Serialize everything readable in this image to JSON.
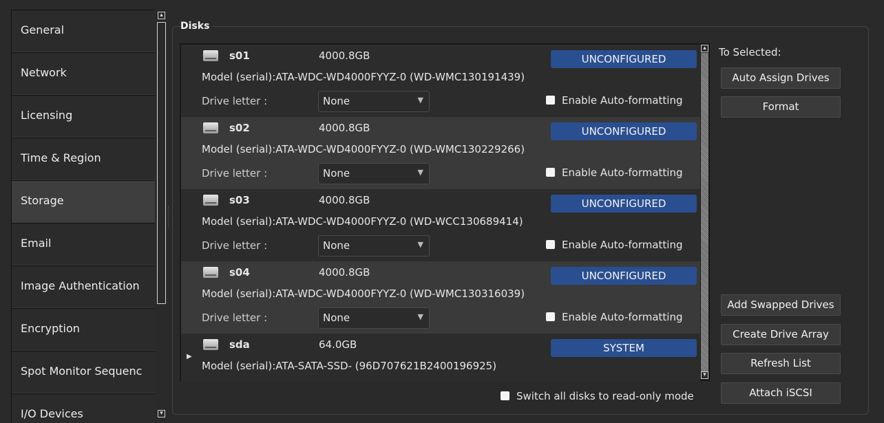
{
  "sidebar": {
    "items": [
      {
        "label": "General"
      },
      {
        "label": "Network"
      },
      {
        "label": "Licensing"
      },
      {
        "label": "Time & Region"
      },
      {
        "label": "Storage"
      },
      {
        "label": "Email"
      },
      {
        "label": "Image Authentication"
      },
      {
        "label": "Encryption"
      },
      {
        "label": "Spot Monitor Sequenc"
      },
      {
        "label": "I/O Devices"
      }
    ],
    "selected": "Storage"
  },
  "disks": {
    "group_title": "Disks",
    "drive_letter_label": "Drive letter :",
    "autoformat_label": "Enable Auto-formatting",
    "items": [
      {
        "name": "s01",
        "size": "4000.8GB",
        "status": "UNCONFIGURED",
        "model": "Model (serial):ATA-WDC-WD4000FYYZ-0 (WD-WMC130191439)",
        "drive_letter": "None"
      },
      {
        "name": "s02",
        "size": "4000.8GB",
        "status": "UNCONFIGURED",
        "model": "Model (serial):ATA-WDC-WD4000FYYZ-0 (WD-WMC130229266)",
        "drive_letter": "None"
      },
      {
        "name": "s03",
        "size": "4000.8GB",
        "status": "UNCONFIGURED",
        "model": "Model (serial):ATA-WDC-WD4000FYYZ-0 (WD-WCC130689414)",
        "drive_letter": "None"
      },
      {
        "name": "s04",
        "size": "4000.8GB",
        "status": "UNCONFIGURED",
        "model": "Model (serial):ATA-WDC-WD4000FYYZ-0 (WD-WMC130316039)",
        "drive_letter": "None"
      },
      {
        "name": "sda",
        "size": "64.0GB",
        "status": "SYSTEM",
        "model": "Model (serial):ATA-SATA-SSD- (96D707621B2400196925)"
      }
    ],
    "readonly_label": "Switch all disks to read-only mode"
  },
  "actions": {
    "to_selected_label": "To Selected:",
    "auto_assign": "Auto Assign Drives",
    "format": "Format",
    "add_swapped": "Add Swapped Drives",
    "create_array": "Create Drive Array",
    "refresh": "Refresh List",
    "attach_iscsi": "Attach iSCSI"
  },
  "icons": {
    "drive": "hard-drive-icon",
    "select_caret": "chevron-down-icon",
    "expander": "triangle-right-icon",
    "scroll_up": "scroll-up-icon",
    "scroll_down": "scroll-down-icon"
  },
  "colors": {
    "background": "#2a2a2a",
    "status_badge": "#2a4f90",
    "row_light": "#3a3a3a",
    "row_dark": "#2c2c2c"
  }
}
